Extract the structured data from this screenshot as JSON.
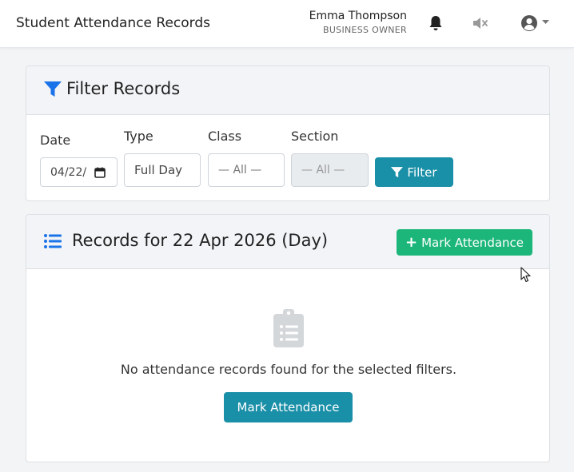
{
  "header": {
    "title": "Student Attendance Records",
    "user_name": "Emma Thompson",
    "user_role": "BUSINESS OWNER"
  },
  "filter": {
    "title": "Filter Records",
    "date_label": "Date",
    "date_value": "04/22/",
    "type_label": "Type",
    "type_value": "Full Day",
    "class_label": "Class",
    "class_value": "— All —",
    "section_label": "Section",
    "section_value": "— All —",
    "filter_button": "Filter"
  },
  "records": {
    "title": "Records for 22 Apr 2026 (Day)",
    "mark_button_top": "Mark Attendance",
    "empty_message": "No attendance records found for the selected filters.",
    "mark_button_main": "Mark Attendance"
  },
  "colors": {
    "accent_blue": "#1a8fa8",
    "accent_green": "#1db67a",
    "icon_blue": "#1a73e8"
  }
}
